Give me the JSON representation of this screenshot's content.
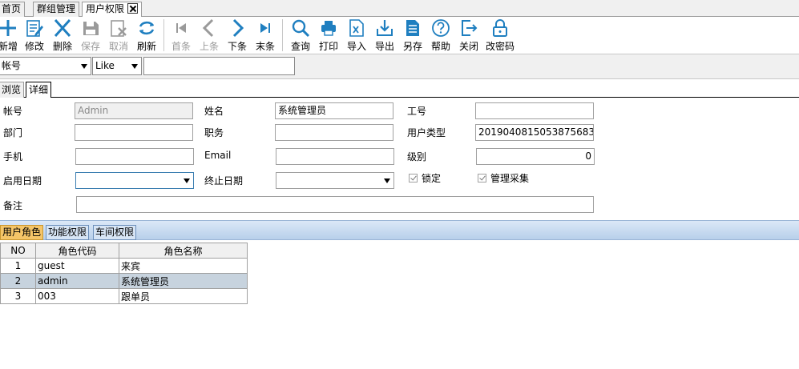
{
  "doc_tabs": [
    "首页",
    "群组管理",
    "用户权限"
  ],
  "toolbar": [
    {
      "label": "新增",
      "icon": "plus-icon",
      "enabled": true
    },
    {
      "label": "修改",
      "icon": "edit-icon",
      "enabled": true
    },
    {
      "label": "删除",
      "icon": "delete-icon",
      "enabled": true
    },
    {
      "label": "保存",
      "icon": "save-icon",
      "enabled": false
    },
    {
      "label": "取消",
      "icon": "cancel-icon",
      "enabled": false
    },
    {
      "label": "刷新",
      "icon": "refresh-icon",
      "enabled": true
    },
    {
      "label": "首条",
      "icon": "first-icon",
      "enabled": false
    },
    {
      "label": "上条",
      "icon": "prev-icon",
      "enabled": false
    },
    {
      "label": "下条",
      "icon": "next-icon",
      "enabled": true
    },
    {
      "label": "末条",
      "icon": "last-icon",
      "enabled": true
    },
    {
      "label": "查询",
      "icon": "search-icon",
      "enabled": true
    },
    {
      "label": "打印",
      "icon": "print-icon",
      "enabled": true
    },
    {
      "label": "导入",
      "icon": "import-icon",
      "enabled": true
    },
    {
      "label": "导出",
      "icon": "export-icon",
      "enabled": true
    },
    {
      "label": "另存",
      "icon": "save-as-icon",
      "enabled": true
    },
    {
      "label": "帮助",
      "icon": "help-icon",
      "enabled": true
    },
    {
      "label": "关闭",
      "icon": "close-icon",
      "enabled": true
    },
    {
      "label": "改密码",
      "icon": "lock-icon",
      "enabled": true
    }
  ],
  "filter": {
    "field": "帐号",
    "operator": "Like",
    "value": ""
  },
  "view_tabs": [
    "浏览",
    "详细"
  ],
  "form": {
    "account_label": "帐号",
    "account_value": "Admin",
    "name_label": "姓名",
    "name_value": "系统管理员",
    "empno_label": "工号",
    "empno_value": "",
    "dept_label": "部门",
    "dept_value": "",
    "position_label": "职务",
    "position_value": "",
    "usertype_label": "用户类型",
    "usertype_value": "2019040815053875683",
    "phone_label": "手机",
    "phone_value": "",
    "email_label": "Email",
    "email_value": "",
    "level_label": "级别",
    "level_value": "0",
    "start_label": "启用日期",
    "start_value": "",
    "end_label": "终止日期",
    "end_value": "",
    "lock_label": "锁定",
    "manage_label": "管理采集",
    "remark_label": "备注",
    "remark_value": ""
  },
  "sub_tabs": [
    "用户角色",
    "功能权限",
    "车间权限"
  ],
  "grid": {
    "headers": [
      "NO",
      "角色代码",
      "角色名称"
    ],
    "rows": [
      {
        "no": "1",
        "code": "guest",
        "name": "来宾"
      },
      {
        "no": "2",
        "code": "admin",
        "name": "系统管理员"
      },
      {
        "no": "3",
        "code": "003",
        "name": "跟单员"
      }
    ]
  },
  "colors": {
    "accent_blue": "#1f7fc0",
    "disabled_gray": "#9a9a9a",
    "active_subtab": "#f5c568",
    "selected_row": "#c7d3de"
  }
}
